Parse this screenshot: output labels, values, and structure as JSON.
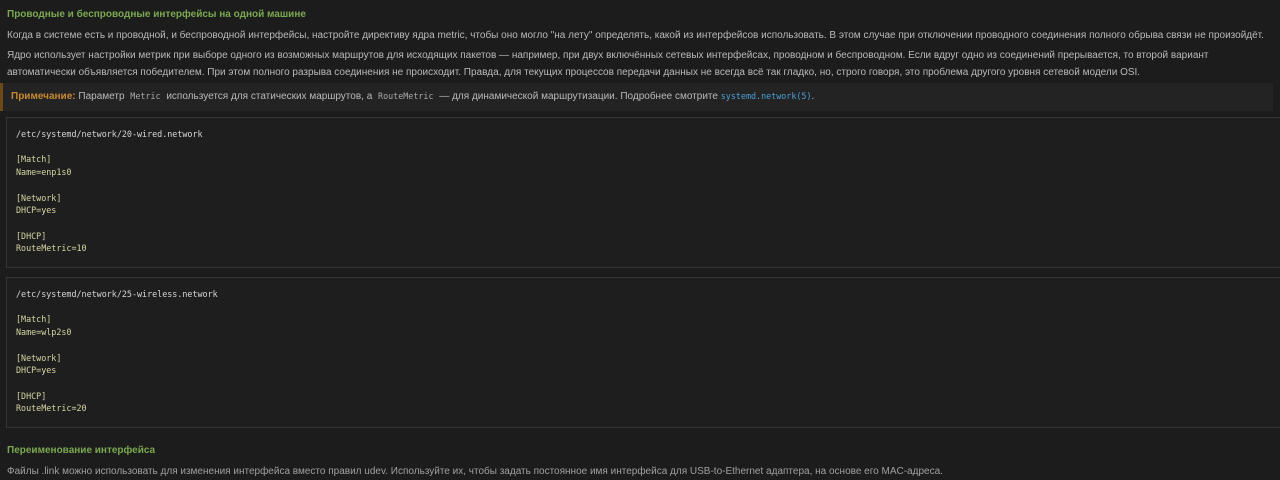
{
  "section1": {
    "heading": "Проводные и беспроводные интерфейсы на одной машине",
    "para1": "Когда в системе есть и проводной, и беспроводной интерфейсы, настройте директиву ядра metric, чтобы оно могло \"на лету\" определять, какой из интерфейсов использовать. В этом случае при отключении проводного соединения полного обрыва связи не произойдёт.",
    "para2": "Ядро использует настройки метрик при выборе одного из возможных маршрутов для исходящих пакетов — например, при двух включённых сетевых интерфейсах, проводном и беспроводном. Если вдруг одно из соединений прерывается, то второй вариант автоматически объявляется победителем. При этом полного разрыва соединения не происходит. Правда, для текущих процессов передачи данных не всегда всё так гладко, но, строго говоря, это проблема другого уровня сетевой модели OSI."
  },
  "note": {
    "label": "Примечание:",
    "text1": "Параметр",
    "code1": "Metric",
    "text2": "используется для статических маршрутов, а",
    "code2": "RouteMetric",
    "text3": "— для динамической маршрутизации. Подробнее смотрите",
    "link": "systemd.network(5)",
    "text4": "."
  },
  "code_blocks": [
    {
      "path": "/etc/systemd/network/20-wired.network",
      "body": "[Match]\nName=enp1s0\n\n[Network]\nDHCP=yes\n\n[DHCP]\nRouteMetric=10"
    },
    {
      "path": "/etc/systemd/network/25-wireless.network",
      "body": "[Match]\nName=wlp2s0\n\n[Network]\nDHCP=yes\n\n[DHCP]\nRouteMetric=20"
    }
  ],
  "section2": {
    "heading": "Переименование интерфейса",
    "para_partial": "Файлы .link можно использовать для изменения интерфейса вместо правил udev. Используйте их, чтобы задать постоянное имя интерфейса для USB-to-Ethernet адаптера, на основе его MAC-адреса."
  }
}
